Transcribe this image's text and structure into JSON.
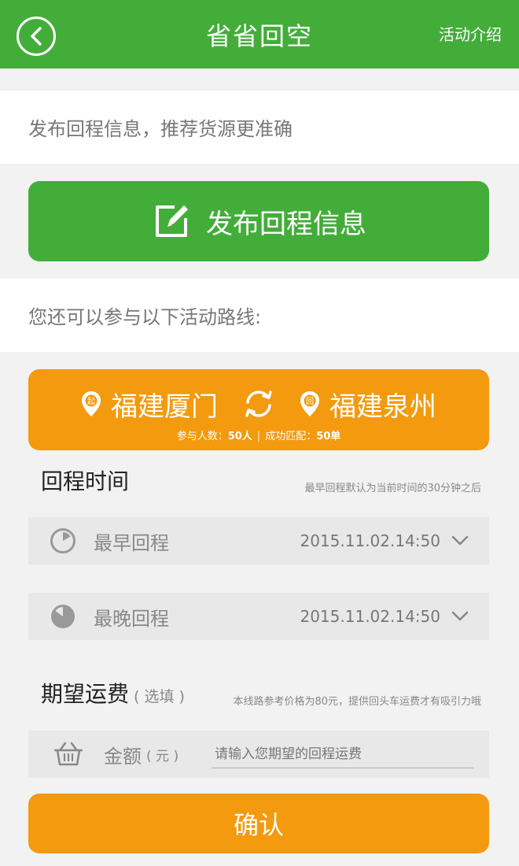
{
  "header": {
    "title": "省省回空",
    "right_link": "活动介绍"
  },
  "tip": "发布回程信息，推荐货源更准确",
  "publish_button": "发布回程信息",
  "routes_tip": "您还可以参与以下活动路线:",
  "route": {
    "from": "福建厦门",
    "to": "福建泉州",
    "from_badge": "起",
    "to_badge": "回",
    "participants_label": "参与人数：",
    "participants_value": "50人",
    "separator": "|",
    "matched_label": "成功匹配：",
    "matched_value": "50单"
  },
  "return_time": {
    "title": "回程时间",
    "note": "最早回程默认为当前时间的30分钟之后",
    "earliest": {
      "label": "最早回程",
      "value": "2015.11.02.14:50"
    },
    "latest": {
      "label": "最晚回程",
      "value": "2015.11.02.14:50"
    }
  },
  "fee": {
    "title": "期望运费",
    "optional": "( 选填 )",
    "note": "本线路参考价格为80元，提供回头车运费才有吸引力哦",
    "label": "金额",
    "unit": "( 元 )",
    "placeholder": "请输入您期望的回程运费",
    "value": ""
  },
  "confirm_button": "确认",
  "colors": {
    "green": "#43ad3a",
    "orange": "#f39a0e",
    "background": "#f2f2f2"
  },
  "icons": [
    "back-arrow-icon",
    "edit-icon",
    "location-pin-icon",
    "swap-icon",
    "clock-icon",
    "clock-filled-icon",
    "chevron-down-icon",
    "basket-icon"
  ]
}
